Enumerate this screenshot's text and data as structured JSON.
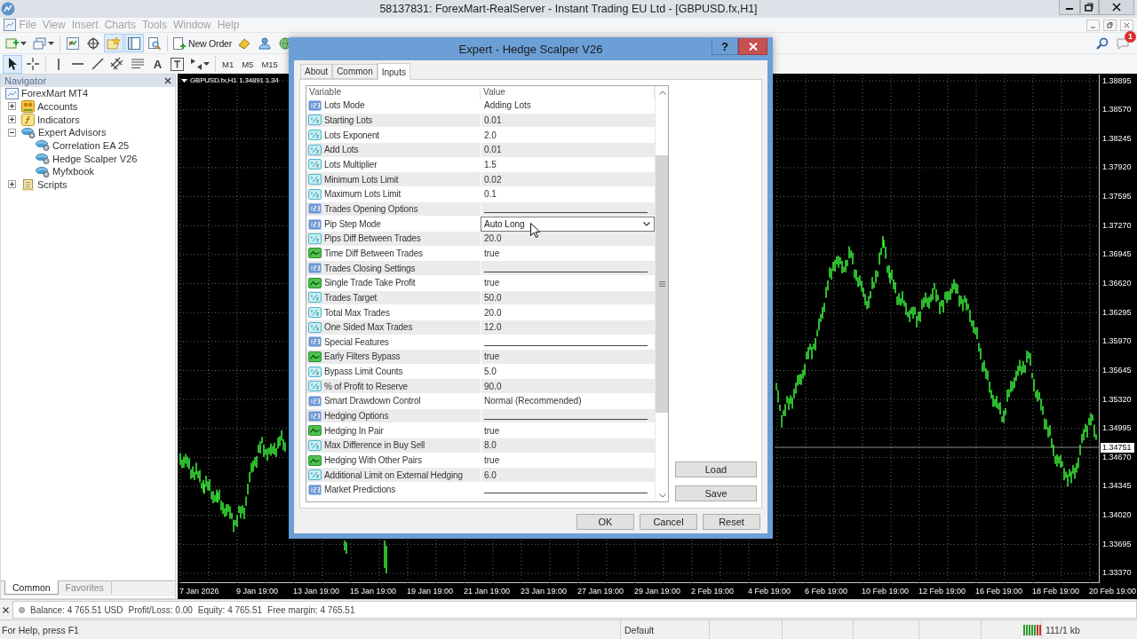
{
  "window": {
    "title": "58137831: ForexMart-RealServer - Instant Trading EU Ltd - [GBPUSD.fx,H1]"
  },
  "menu": [
    {
      "label": "File",
      "disabled": true
    },
    {
      "label": "View",
      "disabled": true
    },
    {
      "label": "Insert",
      "disabled": true
    },
    {
      "label": "Charts",
      "disabled": true
    },
    {
      "label": "Tools",
      "disabled": true
    },
    {
      "label": "Window",
      "disabled": true
    },
    {
      "label": "Help",
      "disabled": true
    }
  ],
  "toolbar_1": [
    {
      "kind": "new_chart",
      "dropdown": true
    },
    {
      "kind": "profiles",
      "dropdown": true
    },
    {
      "kind": "separator"
    },
    {
      "kind": "market_watch",
      "pressed": false
    },
    {
      "kind": "data_window",
      "pressed": false
    },
    {
      "kind": "navigator",
      "pressed": true
    },
    {
      "kind": "terminal",
      "pressed": true
    },
    {
      "kind": "tester",
      "pressed": false
    },
    {
      "kind": "separator"
    },
    {
      "kind": "new_order",
      "label": "New Order"
    },
    {
      "kind": "editor"
    },
    {
      "kind": "account"
    },
    {
      "kind": "web"
    }
  ],
  "toolbar_2": [
    {
      "kind": "cursor",
      "pressed": true
    },
    {
      "kind": "crosshair",
      "pressed": false
    },
    {
      "kind": "separator"
    },
    {
      "kind": "vline"
    },
    {
      "kind": "hline"
    },
    {
      "kind": "trendline"
    },
    {
      "kind": "channel"
    },
    {
      "kind": "fibo"
    },
    {
      "kind": "text",
      "label": "A"
    },
    {
      "kind": "text_label"
    },
    {
      "kind": "arrows",
      "dropdown": true
    },
    {
      "kind": "separator"
    },
    {
      "kind": "timeframe",
      "label": "M1",
      "selected": false
    },
    {
      "kind": "timeframe",
      "label": "M5",
      "selected": false
    },
    {
      "kind": "timeframe",
      "label": "M15",
      "selected": false
    }
  ],
  "notifications": {
    "count": "1"
  },
  "navigator": {
    "title": "Navigator",
    "tree": [
      {
        "label": "ForexMart MT4",
        "kind": "terminal",
        "children": [
          {
            "label": "Accounts",
            "kind": "accounts",
            "expanded": false
          },
          {
            "label": "Indicators",
            "kind": "indicators",
            "expanded": false
          },
          {
            "label": "Expert Advisors",
            "kind": "experts",
            "expanded": true,
            "children": [
              {
                "label": "Correlation EA 25",
                "kind": "expert"
              },
              {
                "label": "Hedge Scalper V26",
                "kind": "expert"
              },
              {
                "label": "Myfxbook",
                "kind": "expert"
              }
            ]
          },
          {
            "label": "Scripts",
            "kind": "scripts",
            "expanded": false
          }
        ]
      }
    ],
    "tabs": [
      {
        "label": "Common",
        "selected": true
      },
      {
        "label": "Favorites",
        "selected": false
      }
    ]
  },
  "chart": {
    "symbol": "GBPUSD.fx,H1",
    "quote": "1.34891 1.34",
    "price_labels": [
      "1.38895",
      "1.38570",
      "1.38245",
      "1.37920",
      "1.37595",
      "1.37270",
      "1.36945",
      "1.36620",
      "1.36295",
      "1.35970",
      "1.35645",
      "1.35320",
      "1.34995",
      "1.34670",
      "1.34345",
      "1.34020",
      "1.33695",
      "1.33370"
    ],
    "current_price": "1.34751",
    "time_labels": [
      "7 Jan 2026",
      "9 Jan 19:00",
      "13 Jan 19:00",
      "15 Jan 19:00",
      "19 Jan 19:00",
      "21 Jan 19:00",
      "23 Jan 19:00",
      "27 Jan 19:00",
      "29 Jan 19:00",
      "2 Feb 19:00",
      "4 Feb 19:00",
      "6 Feb 19:00",
      "10 Feb 19:00",
      "12 Feb 19:00",
      "16 Feb 19:00",
      "18 Feb 19:00",
      "20 Feb 19:00"
    ]
  },
  "dialog": {
    "title": "Expert - Hedge Scalper V26",
    "help": "?",
    "tabs": [
      {
        "label": "About",
        "selected": false
      },
      {
        "label": "Common",
        "selected": false
      },
      {
        "label": "Inputs",
        "selected": true
      }
    ],
    "columns": [
      "Variable",
      "Value"
    ],
    "rows": [
      {
        "kind": "enum",
        "variable": "Lots Mode",
        "value": "Adding Lots",
        "selected": false
      },
      {
        "kind": "double",
        "variable": "Starting Lots",
        "value": "0.01",
        "selected": false
      },
      {
        "kind": "double",
        "variable": "Lots Exponent",
        "value": "2.0",
        "selected": false
      },
      {
        "kind": "double",
        "variable": "Add Lots",
        "value": "0.01",
        "selected": false
      },
      {
        "kind": "double",
        "variable": "Lots Multiplier",
        "value": "1.5",
        "selected": false
      },
      {
        "kind": "double",
        "variable": "Minimum Lots Limit",
        "value": "0.02",
        "selected": false
      },
      {
        "kind": "double",
        "variable": "Maximum Lots Limit",
        "value": "0.1",
        "selected": false
      },
      {
        "kind": "separator",
        "variable": "Trades Opening Options",
        "selected": false
      },
      {
        "kind": "enum",
        "variable": "Pip Step Mode",
        "value": "Auto Long",
        "selected": true
      },
      {
        "kind": "double",
        "variable": "Pips Diff Between Trades",
        "value": "20.0",
        "selected": false
      },
      {
        "kind": "bool",
        "variable": "Time Diff Between Trades",
        "value": "true",
        "selected": false
      },
      {
        "kind": "separator",
        "variable": "Trades Closing Settings",
        "selected": false
      },
      {
        "kind": "bool",
        "variable": "Single Trade Take Profit",
        "value": "true",
        "selected": false
      },
      {
        "kind": "double",
        "variable": "Trades Target",
        "value": "50.0",
        "selected": false
      },
      {
        "kind": "double",
        "variable": "Total Max Trades",
        "value": "20.0",
        "selected": false
      },
      {
        "kind": "double",
        "variable": "One Sided Max Trades",
        "value": "12.0",
        "selected": false
      },
      {
        "kind": "separator",
        "variable": "Special Features",
        "selected": false
      },
      {
        "kind": "bool",
        "variable": "Early Filters Bypass",
        "value": "true",
        "selected": false
      },
      {
        "kind": "double",
        "variable": "Bypass Limit Counts",
        "value": "5.0",
        "selected": false
      },
      {
        "kind": "double",
        "variable": "% of Profit to Reserve",
        "value": "90.0",
        "selected": false
      },
      {
        "kind": "enum",
        "variable": "Smart Drawdown Control",
        "value": "Normal (Recommended)",
        "selected": false
      },
      {
        "kind": "separator",
        "variable": "Hedging Options",
        "selected": false
      },
      {
        "kind": "bool",
        "variable": "Hedging In Pair",
        "value": "true",
        "selected": false
      },
      {
        "kind": "double",
        "variable": "Max Difference in Buy Sell",
        "value": "8.0",
        "selected": false
      },
      {
        "kind": "bool",
        "variable": "Hedging With Other Pairs",
        "value": "true",
        "selected": false
      },
      {
        "kind": "double",
        "variable": "Additional Limit on External Hedging",
        "value": "6.0",
        "selected": false
      },
      {
        "kind": "separator",
        "variable": "Market Predictions",
        "selected": false
      }
    ],
    "side_buttons": [
      "Load",
      "Save"
    ],
    "buttons": [
      "OK",
      "Cancel",
      "Reset"
    ]
  },
  "terminal": {
    "items": [
      "Balance: 4 765.51 USD",
      "Profit/Loss: 0.00",
      "Equity: 4 765.51",
      "Free margin: 4 765.51"
    ]
  },
  "status_bar": {
    "help": "For Help, press F1",
    "profile": "Default",
    "traffic": "111/1 kb"
  }
}
